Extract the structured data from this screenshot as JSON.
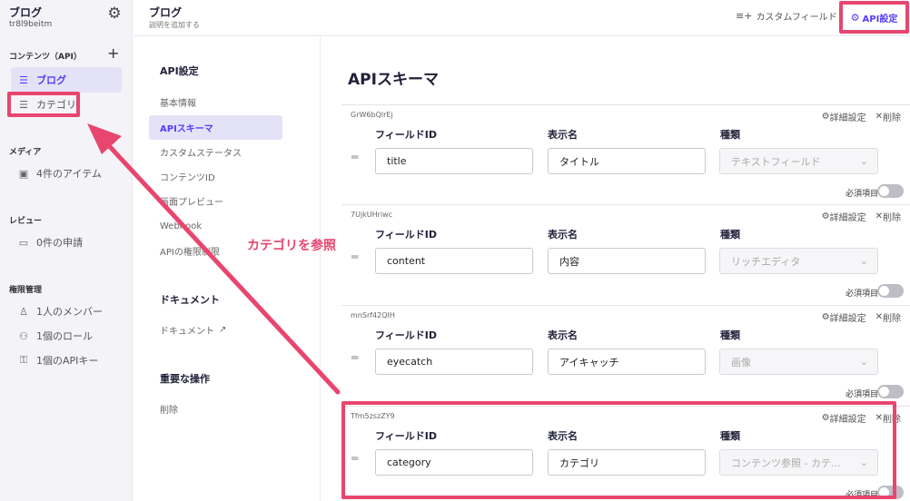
{
  "sidebar": {
    "service_name": "ブログ",
    "service_id": "tr8l9beitm",
    "contents_header": "コンテンツ（API）",
    "apis": [
      {
        "label": "ブログ",
        "icon": "list-icon",
        "active": true
      },
      {
        "label": "カテゴリ",
        "icon": "list-icon",
        "active": false
      }
    ],
    "media_header": "メディア",
    "media_item": "4件のアイテム",
    "review_header": "レビュー",
    "review_item": "0件の申請",
    "perm_header": "権限管理",
    "perm_items": [
      "1人のメンバー",
      "1個のロール",
      "1個のAPIキー"
    ]
  },
  "topbar": {
    "api_name": "ブログ",
    "api_desc": "説明を追加する",
    "custom_field_label": "カスタムフィールド",
    "api_settings_label": "API設定"
  },
  "settings_nav": {
    "api_header": "API設定",
    "api_items": [
      "基本情報",
      "APIスキーマ",
      "カスタムステータス",
      "コンテンツID",
      "画面プレビュー",
      "Webhook",
      "APIの権限制限"
    ],
    "doc_header": "ドキュメント",
    "doc_item": "ドキュメント",
    "danger_header": "重要な操作",
    "danger_item": "削除"
  },
  "main": {
    "title": "APIスキーマ",
    "detail_label": "詳細設定",
    "delete_label": "削除",
    "field_id_label": "フィールドID",
    "display_name_label": "表示名",
    "type_label": "種類",
    "required_label": "必須項目",
    "fields": [
      {
        "key": "GrW6bQlrEj",
        "field_id": "title",
        "display_name": "タイトル",
        "type": "テキストフィールド",
        "required": false
      },
      {
        "key": "7UjkUHriwc",
        "field_id": "content",
        "display_name": "内容",
        "type": "リッチエディタ",
        "required": false
      },
      {
        "key": "mnSrf42QIH",
        "field_id": "eyecatch",
        "display_name": "アイキャッチ",
        "type": "画像",
        "required": false
      },
      {
        "key": "Tfm5zszZY9",
        "field_id": "category",
        "display_name": "カテゴリ",
        "type": "コンテンツ参照 - カテ...",
        "required": false
      }
    ]
  },
  "annotation": {
    "text": "カテゴリを参照",
    "color": "#e8466f"
  },
  "colors": {
    "accent": "#563bff",
    "highlight": "#e8466f"
  }
}
